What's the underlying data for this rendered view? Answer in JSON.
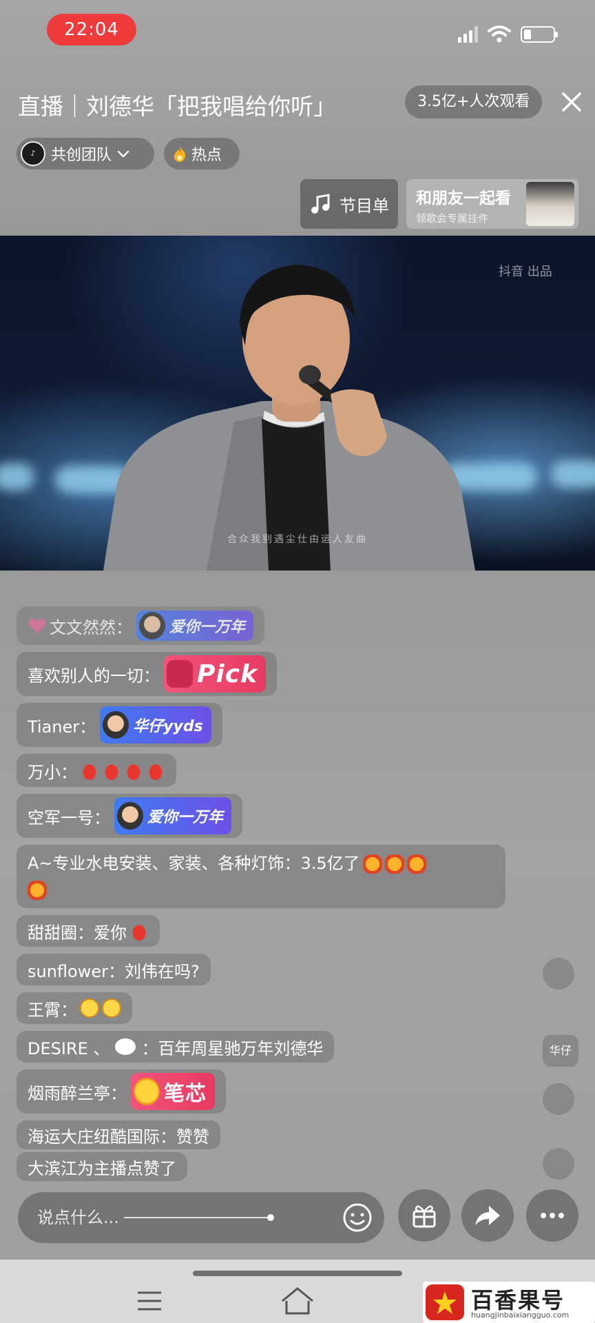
{
  "status": {
    "time": "22:04"
  },
  "header": {
    "title": "直播｜刘德华「把我唱给你听」",
    "viewers": "3.5亿+人次观看",
    "team": "共创团队",
    "hot": "热点",
    "program_list": "节目单",
    "watch_together": {
      "title": "和朋友一起看",
      "subtitle": "领歌会专属挂件"
    }
  },
  "video": {
    "logo": "抖音 出品",
    "subtitle": "合众我别遇尘仕由运人友曲"
  },
  "comments": [
    {
      "name": "文文然然：",
      "gift": "爱你一万年"
    },
    {
      "name": "喜欢别人的一切：",
      "gift": "Pick"
    },
    {
      "name": "Tianer：",
      "gift": "华仔yyds"
    },
    {
      "name": "万小："
    },
    {
      "name": "空军一号：",
      "gift": "爱你一万年"
    },
    {
      "name": "A~专业水电安装、家装、各种灯饰：",
      "text": "3.5亿了"
    },
    {
      "name": "甜甜圈：",
      "text": "爱你"
    },
    {
      "name": "sunflower：",
      "text": "刘伟在吗?"
    },
    {
      "name": "王霄："
    },
    {
      "name": "DESIRE 、",
      "name_suffix": "：",
      "text": "百年周星驰万年刘德华"
    },
    {
      "name": "烟雨醉兰亭：",
      "gift": "笔芯"
    },
    {
      "name": "海运大庄纽酷国际：",
      "text": "赞赞"
    },
    {
      "name": "大滨江",
      "text": " 为主播点赞了"
    }
  ],
  "side_icons": {
    "huazai": "华仔"
  },
  "input": {
    "placeholder": "说点什么..."
  },
  "watermark": {
    "title": "百香果号",
    "url": "huangjinbaixiangguo.com"
  },
  "colors": {
    "accent": "#ef3b3b",
    "gift_blue": "#3f7bf2",
    "gift_pink": "#f2547a"
  }
}
